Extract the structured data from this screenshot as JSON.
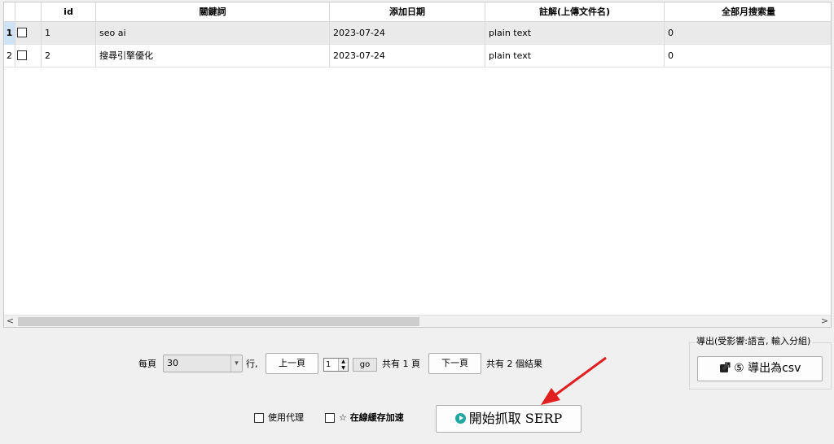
{
  "table": {
    "columns": [
      "id",
      "關鍵詞",
      "添加日期",
      "註解(上傳文件名)",
      "全部月搜索量"
    ],
    "rows": [
      {
        "num": "1",
        "id": "1",
        "keyword": "seo ai",
        "date": "2023-07-24",
        "note": "plain text",
        "volume": "0",
        "selected": true
      },
      {
        "num": "2",
        "id": "2",
        "keyword": "搜尋引擎優化",
        "date": "2023-07-24",
        "note": "plain text",
        "volume": "0",
        "selected": false
      }
    ],
    "scroll_left_glyph": "<",
    "scroll_right_glyph": ">"
  },
  "pagination": {
    "per_page_label": "每頁",
    "per_page_value": "30",
    "rows_suffix": "行,",
    "prev_label": "上一頁",
    "page_value": "1",
    "go_label": "go",
    "total_pages_text": "共有 1 頁",
    "next_label": "下一頁",
    "total_results_text": "共有 2 個結果"
  },
  "export": {
    "group_title": "導出(受影響:語言, 輸入分組)",
    "button_label": "⑤ 導出為csv"
  },
  "bottom": {
    "proxy_label": "使用代理",
    "cache_label": "☆ 在線緩存加速",
    "start_label": "開始抓取 SERP"
  },
  "colors": {
    "selected_row": "#eaeaea",
    "row_header_selected": "#cfe3f6",
    "play_icon": "#20a7a0",
    "arrow_annotation": "#e02020"
  }
}
